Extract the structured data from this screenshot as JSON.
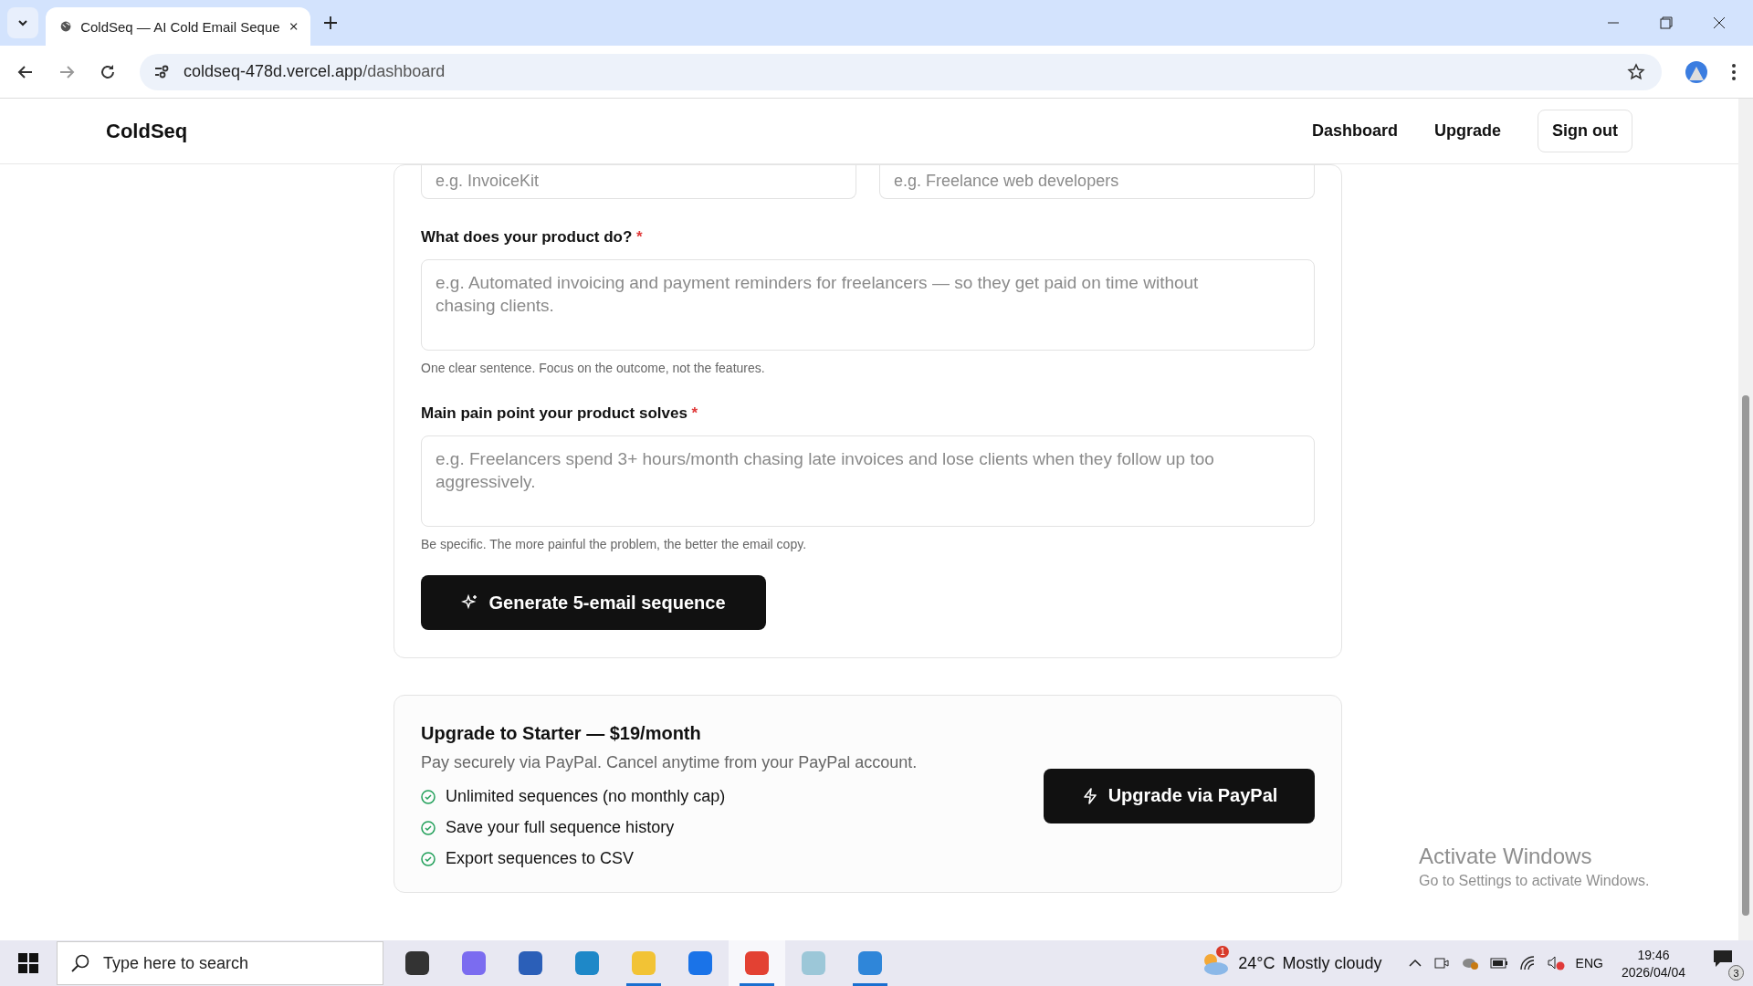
{
  "browser": {
    "tabs": [
      {
        "title": "ColdSeq — AI Cold Email Seque",
        "selected": true
      }
    ],
    "url_host": "coldseq-478d.vercel.app",
    "url_path": "/dashboard"
  },
  "header": {
    "logo": "ColdSeq",
    "nav": [
      {
        "label": "Dashboard",
        "kind": "link"
      },
      {
        "label": "Upgrade",
        "kind": "link"
      },
      {
        "label": "Sign out",
        "kind": "button"
      }
    ]
  },
  "form": {
    "inputs": [
      {
        "placeholder": "e.g. InvoiceKit"
      },
      {
        "placeholder": "e.g. Freelance web developers"
      }
    ],
    "textareas": [
      {
        "label": "What does your product do?",
        "mark": "*",
        "placeholder": "e.g. Automated invoicing and payment reminders for freelancers — so they get paid on time without chasing clients.",
        "help": "One clear sentence. Focus on the outcome, not the features."
      },
      {
        "label": "Main pain point your product solves",
        "mark": "*",
        "placeholder": "e.g. Freelancers spend 3+ hours/month chasing late invoices and lose clients when they follow up too aggressively.",
        "help": "Be specific. The more painful the problem, the better the email copy."
      }
    ],
    "generate_button": "Generate 5-email sequence"
  },
  "upgrade": {
    "title": "Upgrade to Starter — $19/month",
    "subtitle": "Pay securely via PayPal. Cancel anytime from your PayPal account.",
    "features": [
      "Unlimited sequences (no monthly cap)",
      "Save your full sequence history",
      "Export sequences to CSV"
    ],
    "button": "Upgrade via PayPal"
  },
  "watermark": {
    "title": "Activate Windows",
    "subtitle": "Go to Settings to activate Windows."
  },
  "taskbar": {
    "search_placeholder": "Type here to search",
    "apps": [
      {
        "kind": "taskview",
        "running": false,
        "selected": false
      },
      {
        "kind": "copilot",
        "running": false,
        "selected": false
      },
      {
        "kind": "store",
        "running": false,
        "selected": false
      },
      {
        "kind": "edge",
        "running": false,
        "selected": false
      },
      {
        "kind": "files",
        "running": true,
        "selected": false
      },
      {
        "kind": "outlook",
        "running": false,
        "selected": false
      },
      {
        "kind": "chrome",
        "running": true,
        "selected": true
      },
      {
        "kind": "notepad",
        "running": false,
        "selected": false
      },
      {
        "kind": "photos",
        "running": true,
        "selected": false
      }
    ],
    "weather": {
      "badge": "1",
      "temperature": "24°C",
      "condition": "Mostly cloudy"
    },
    "language": "ENG",
    "time": "19:46",
    "date": "2026/04/04",
    "notifications": "3"
  }
}
